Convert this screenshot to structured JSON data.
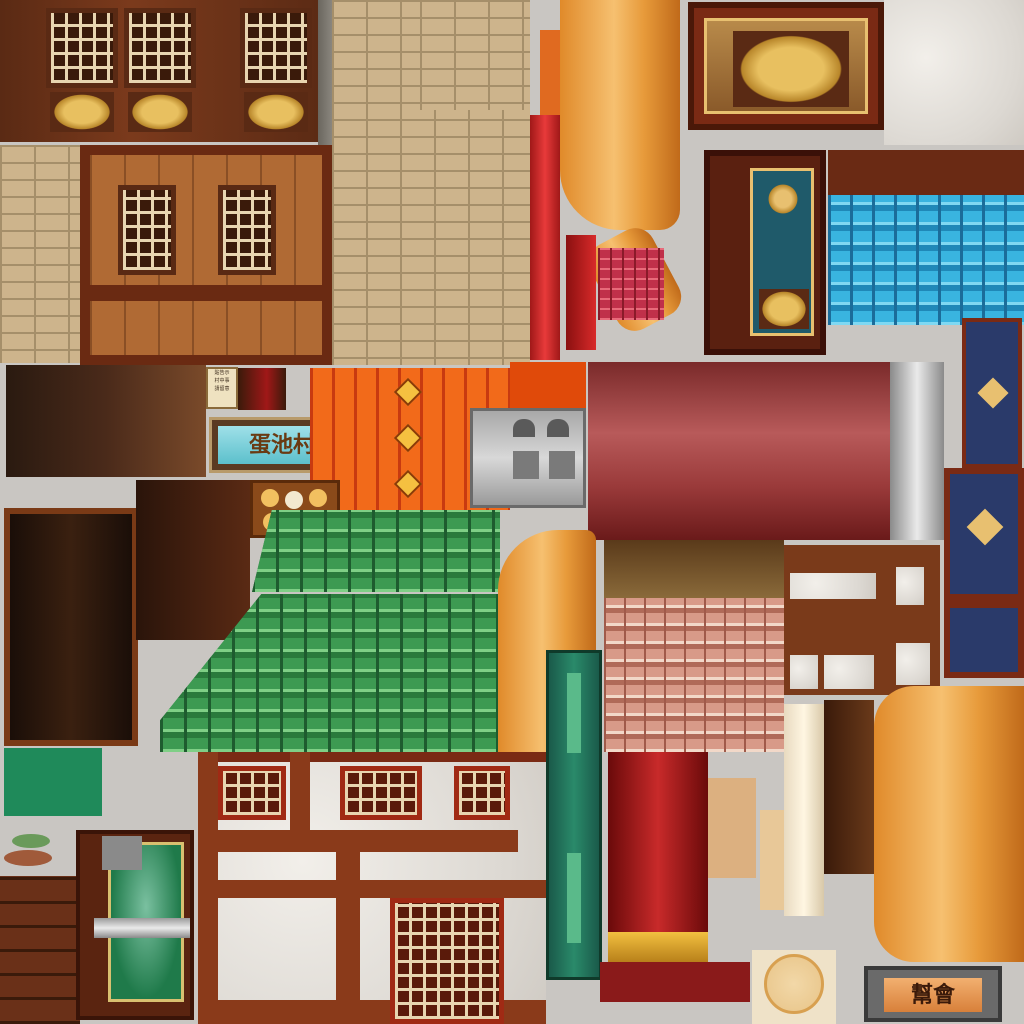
{
  "atlas": {
    "name": "chinese-building-texture-atlas"
  },
  "signs": {
    "village_sign": "蛋池村",
    "guild_sign": "幫會",
    "notice_lines": [
      "貼告示",
      "村中事",
      "請留意"
    ]
  },
  "colors": {
    "background": "#c9c6c2",
    "roof_green": "#2f8a46",
    "roof_blue": "#2ca8d8",
    "roof_terracotta": "#d8a090",
    "lacquer_red": "#9a2a2a",
    "scroll_gold": "#f0b050",
    "wood_brown": "#7b3a1c",
    "jade_green": "#1f7a4a"
  },
  "icons": {
    "dragon": "dragon-icon",
    "buns": "steamed-buns-icon",
    "fish": "fish-icon",
    "lantern": "lantern-icon"
  }
}
